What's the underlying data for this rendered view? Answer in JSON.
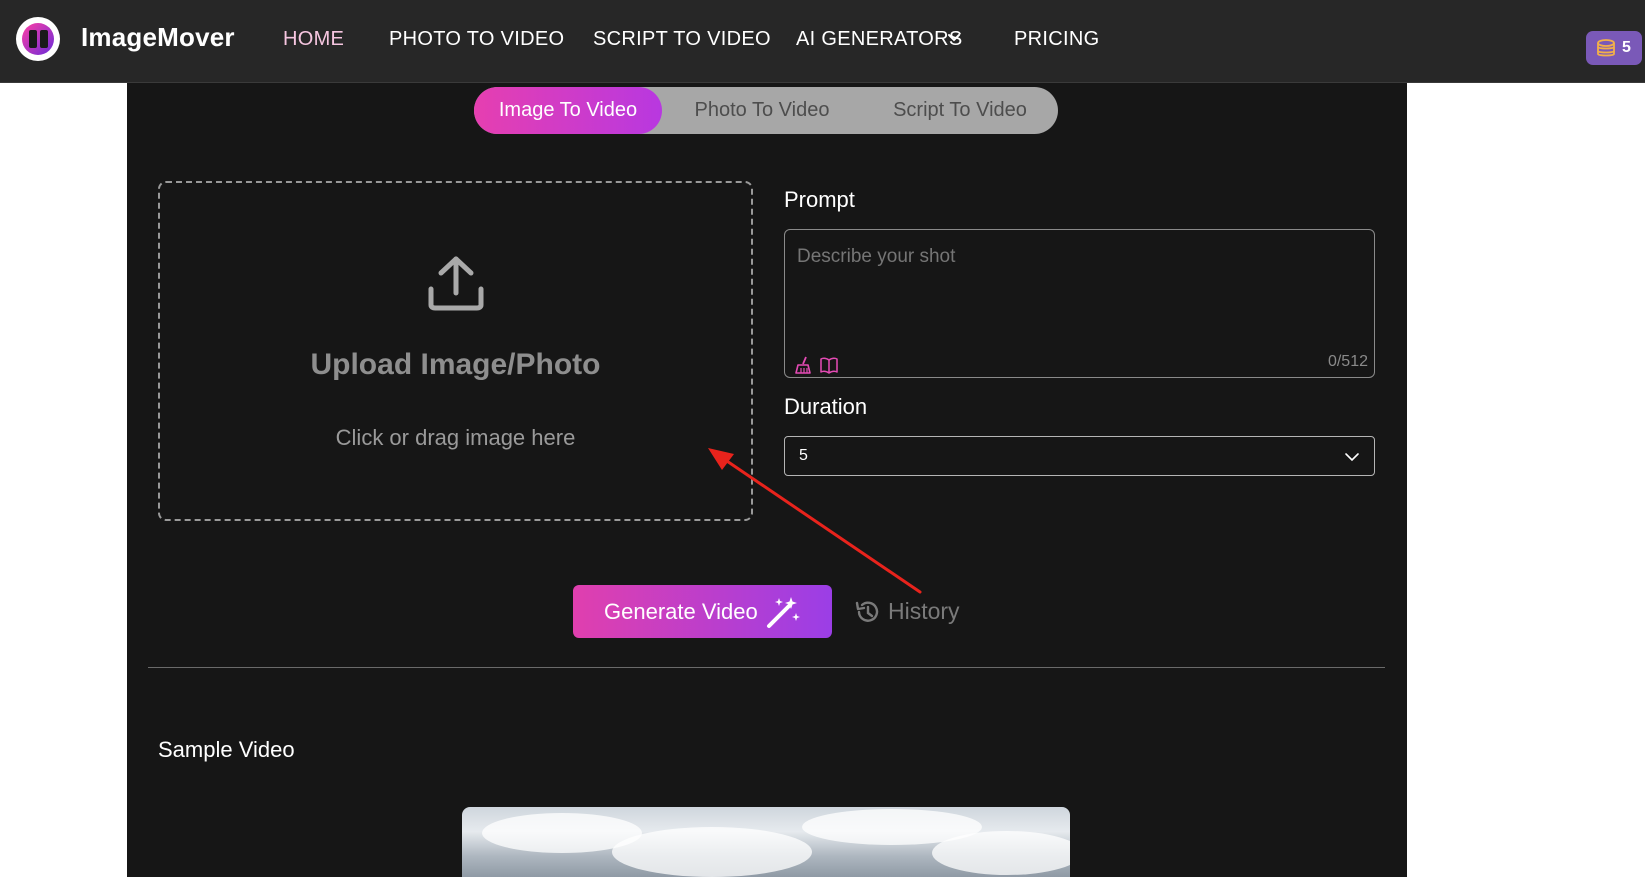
{
  "nav": {
    "brand": "ImageMover",
    "links": [
      "HOME",
      "PHOTO TO VIDEO",
      "SCRIPT TO VIDEO",
      "AI GENERATORS",
      "PRICING"
    ],
    "credits": "5",
    "colors": {
      "background": "#272727",
      "active_link": "#f6c6e0",
      "badge": "#7a59b8"
    }
  },
  "tabs": [
    "Image To Video",
    "Photo To Video",
    "Script To Video"
  ],
  "upload": {
    "title": "Upload Image/Photo",
    "subtitle": "Click or drag image here"
  },
  "prompt": {
    "label": "Prompt",
    "placeholder": "Describe your shot",
    "counter": "0/512"
  },
  "duration": {
    "label": "Duration",
    "value": "5"
  },
  "actions": {
    "generate_label": "Generate Video",
    "history_label": "History"
  },
  "sample": {
    "title": "Sample Video"
  },
  "colors": {
    "accent_start": "#e03fae",
    "accent_end": "#9b3ee6",
    "panel": "#161616",
    "annotation_arrow": "#e8231c"
  },
  "icons": [
    "upload-icon",
    "chevron-down-icon",
    "coin-stack-icon",
    "magic-wand-icon",
    "history-icon",
    "broom-icon",
    "book-icon"
  ]
}
